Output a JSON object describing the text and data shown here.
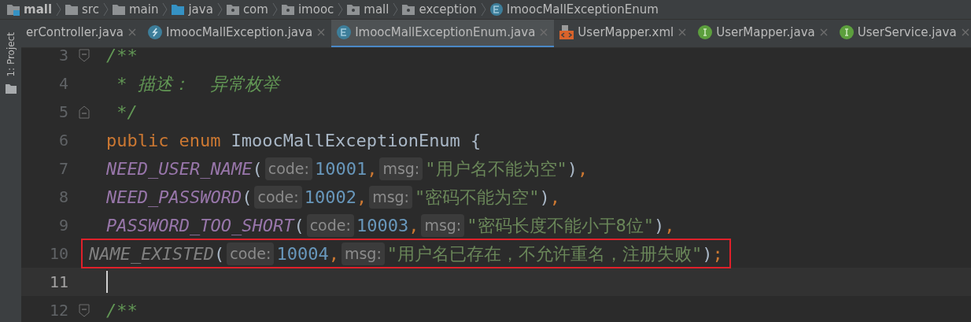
{
  "breadcrumbs": [
    {
      "label": "mall",
      "kind": "module"
    },
    {
      "label": "src",
      "kind": "folder"
    },
    {
      "label": "main",
      "kind": "folder"
    },
    {
      "label": "java",
      "kind": "source-folder"
    },
    {
      "label": "com",
      "kind": "package"
    },
    {
      "label": "imooc",
      "kind": "package"
    },
    {
      "label": "mall",
      "kind": "package"
    },
    {
      "label": "exception",
      "kind": "package"
    },
    {
      "label": "ImoocMallExceptionEnum",
      "kind": "enum"
    }
  ],
  "tool_strip": {
    "label": "1: Project"
  },
  "tabs": [
    {
      "label": "erController.java",
      "kind": "none",
      "selected": false
    },
    {
      "label": "ImoocMallException.java",
      "kind": "exception",
      "selected": false
    },
    {
      "label": "ImoocMallExceptionEnum.java",
      "kind": "enum",
      "selected": true
    },
    {
      "label": "UserMapper.xml",
      "kind": "xml",
      "selected": false
    },
    {
      "label": "UserMapper.java",
      "kind": "interface",
      "selected": false
    },
    {
      "label": "UserService.java",
      "kind": "interface",
      "selected": false
    }
  ],
  "editor": {
    "lines": [
      {
        "number": "3",
        "fold_start": true,
        "fold_end": false,
        "current": false,
        "boxed": false,
        "tokens": [
          {
            "kind": "comment",
            "text": "/**"
          }
        ]
      },
      {
        "number": "4",
        "fold_start": false,
        "fold_end": false,
        "current": false,
        "boxed": false,
        "tokens": [
          {
            "kind": "comment",
            "text": " * 描述：  异常枚举"
          }
        ]
      },
      {
        "number": "5",
        "fold_start": false,
        "fold_end": true,
        "current": false,
        "boxed": false,
        "tokens": [
          {
            "kind": "comment",
            "text": " */"
          }
        ]
      },
      {
        "number": "6",
        "fold_start": false,
        "fold_end": false,
        "current": false,
        "boxed": false,
        "tokens": [
          {
            "kind": "keyword",
            "text": "public"
          },
          {
            "kind": "keyword",
            "text": "enum"
          },
          {
            "kind": "plain",
            "text": "ImoocMallExceptionEnum {"
          }
        ],
        "children": [
          {
            "number": "7",
            "fold_start": false,
            "fold_end": false,
            "current": false,
            "boxed": false,
            "tokens": [
              {
                "kind": "constant",
                "text": "NEED_USER_NAME"
              },
              {
                "kind": "plain",
                "text": "("
              },
              {
                "kind": "hint",
                "text": "code:"
              },
              {
                "kind": "number",
                "text": "10001"
              },
              {
                "kind": "comma",
                "text": ","
              },
              {
                "kind": "hint",
                "text": "msg:"
              },
              {
                "kind": "string",
                "text": "\"用户名不能为空\""
              },
              {
                "kind": "plain",
                "text": ")"
              },
              {
                "kind": "comma",
                "text": ","
              }
            ]
          },
          {
            "number": "8",
            "fold_start": false,
            "fold_end": false,
            "current": false,
            "boxed": false,
            "tokens": [
              {
                "kind": "constant",
                "text": "NEED_PASSWORD"
              },
              {
                "kind": "plain",
                "text": "("
              },
              {
                "kind": "hint",
                "text": "code:"
              },
              {
                "kind": "number",
                "text": "10002"
              },
              {
                "kind": "comma",
                "text": ","
              },
              {
                "kind": "hint",
                "text": "msg:"
              },
              {
                "kind": "string",
                "text": "\"密码不能为空\""
              },
              {
                "kind": "plain",
                "text": ")"
              },
              {
                "kind": "comma",
                "text": ","
              }
            ]
          },
          {
            "number": "9",
            "fold_start": false,
            "fold_end": false,
            "current": false,
            "boxed": false,
            "tokens": [
              {
                "kind": "constant",
                "text": "PASSWORD_TOO_SHORT"
              },
              {
                "kind": "plain",
                "text": "("
              },
              {
                "kind": "hint",
                "text": "code:"
              },
              {
                "kind": "number",
                "text": "10003"
              },
              {
                "kind": "comma",
                "text": ","
              },
              {
                "kind": "hint",
                "text": "msg:"
              },
              {
                "kind": "string",
                "text": "\"密码长度不能小于8位\""
              },
              {
                "kind": "plain",
                "text": ")"
              },
              {
                "kind": "comma",
                "text": ","
              }
            ]
          },
          {
            "number": "10",
            "fold_start": false,
            "fold_end": false,
            "current": false,
            "boxed": true,
            "tokens": [
              {
                "kind": "unused",
                "text": "NAME_EXISTED"
              },
              {
                "kind": "plain",
                "text": "("
              },
              {
                "kind": "hint",
                "text": "code:"
              },
              {
                "kind": "number",
                "text": "10004"
              },
              {
                "kind": "comma",
                "text": ","
              },
              {
                "kind": "hint",
                "text": "msg:"
              },
              {
                "kind": "string",
                "text": "\"用户名已存在，不允许重名，注册失败\""
              },
              {
                "kind": "plain",
                "text": ")"
              },
              {
                "kind": "comma",
                "text": ";"
              }
            ]
          },
          {
            "number": "11",
            "fold_start": false,
            "fold_end": false,
            "current": true,
            "boxed": false
          },
          {
            "number": "12",
            "fold_start": true,
            "fold_end": false,
            "current": false,
            "boxed": false,
            "tokens": [
              {
                "kind": "comment",
                "text": "/**"
              }
            ]
          }
        ]
      }
    ]
  }
}
